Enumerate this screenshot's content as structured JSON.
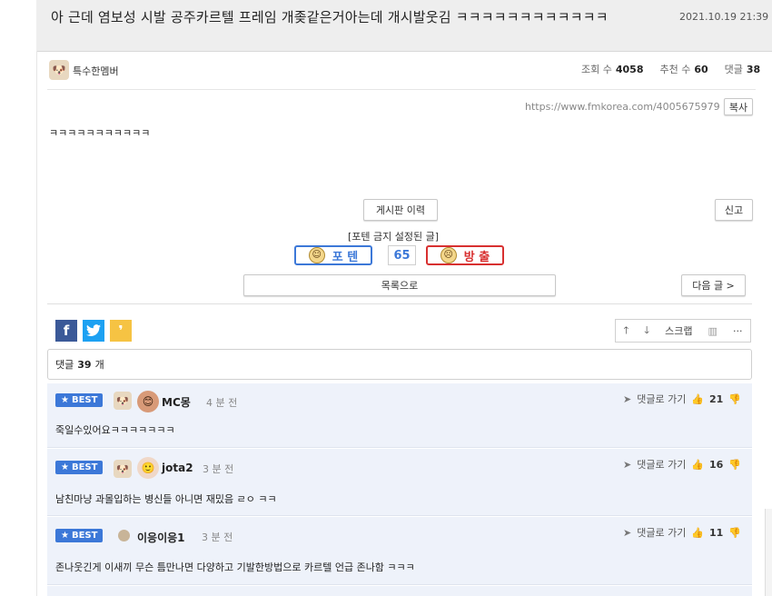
{
  "post": {
    "title": "아 근데 염보성 시발 공주카르텔 프레임 개좆같은거아는데 개시발웃김 ㅋㅋㅋㅋㅋㅋㅋㅋㅋㅋㅋㅋ",
    "date": "2021.10.19 21:39",
    "author": "특수한멤버",
    "views_label": "조회 수",
    "views": "4058",
    "recommend_label": "추천 수",
    "recommend": "60",
    "comments_label": "댓글",
    "comments": "38",
    "url": "https://www.fmkorea.com/4005675979",
    "copy_label": "복사",
    "body": "ㅋㅋㅋㅋㅋㅋㅋㅋㅋㅋㅋ"
  },
  "actions": {
    "history": "게시판 이력",
    "report": "신고",
    "forbidden_note": "[포텐 금지 설정된 글]",
    "poten": "포 텐",
    "score": "65",
    "bangchul": "방 출",
    "list": "목록으로",
    "next": "다음 글 >"
  },
  "share": {
    "scrap": "스크랩",
    "more": "···"
  },
  "comments_header": {
    "label": "댓글",
    "count": "39",
    "unit": "개"
  },
  "comments": [
    {
      "badge": "BEST",
      "name": "MC몽",
      "time": "4 분 전",
      "text": "죽일수있어요ㅋㅋㅋㅋㅋㅋㅋ",
      "reply": "댓글로 가기",
      "likes": "21"
    },
    {
      "badge": "BEST",
      "name": "jota2",
      "time": "3 분 전",
      "text": "남친마냥 과몰입하는 병신들 아니면 재밌음 ㄹㅇ ㅋㅋ",
      "reply": "댓글로 가기",
      "likes": "16"
    },
    {
      "badge": "BEST",
      "name": "이응이응1",
      "time": "3 분 전",
      "text": "존나웃긴게 이새끼 무슨 틈만나면 다양하고 기발한방법으로 카르텔 언급 존나함 ㅋㅋㅋ",
      "reply": "댓글로 가기",
      "likes": "11"
    }
  ],
  "colors": {
    "accent_blue": "#3c78d8",
    "facebook": "#3b5998",
    "twitter": "#1da1f2",
    "kakao": "#f6c343",
    "poten_blue": "#3c78d8",
    "bangchul_red": "#d83030"
  }
}
